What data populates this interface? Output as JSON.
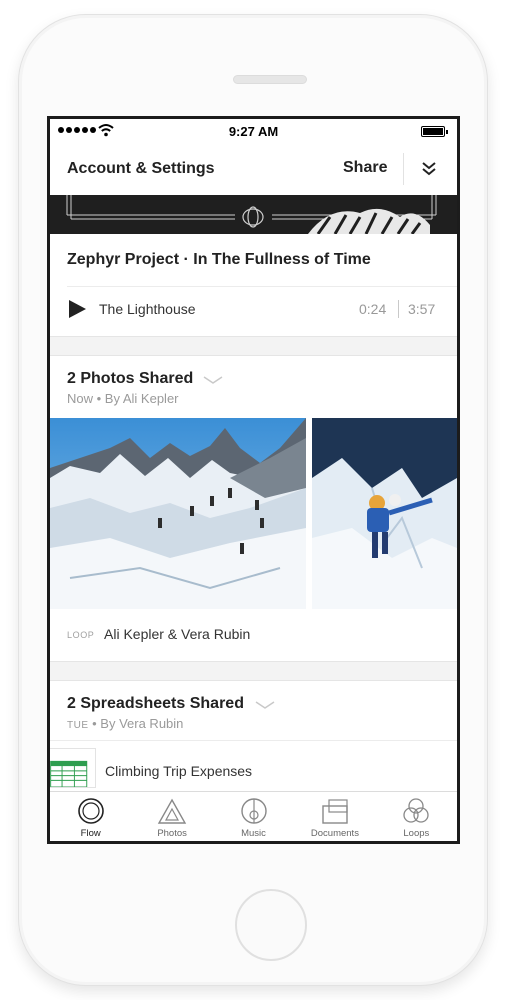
{
  "status_bar": {
    "time": "9:27 AM"
  },
  "header": {
    "title": "Account & Settings",
    "share_label": "Share"
  },
  "music_card": {
    "title": "Zephyr Project · In The Fullness of Time",
    "track": "The Lighthouse",
    "elapsed": "0:24",
    "duration": "3:57"
  },
  "photos_card": {
    "title": "2 Photos Shared",
    "meta_time": "Now",
    "meta_author": "• By Ali Kepler",
    "loop_label": "LOOP",
    "loop_members": "Ali Kepler & Vera Rubin"
  },
  "sheets_card": {
    "title": "2 Spreadsheets Shared",
    "meta_time": "TUE",
    "meta_author": "• By Vera Rubin",
    "file_name": "Climbing Trip Expenses"
  },
  "tabs": [
    {
      "label": "Flow",
      "icon": "flow-icon",
      "active": true
    },
    {
      "label": "Photos",
      "icon": "photos-icon",
      "active": false
    },
    {
      "label": "Music",
      "icon": "music-icon",
      "active": false
    },
    {
      "label": "Documents",
      "icon": "documents-icon",
      "active": false
    },
    {
      "label": "Loops",
      "icon": "loops-icon",
      "active": false
    }
  ],
  "colors": {
    "screen_bg": "#f3f3f3",
    "card_bg": "#ffffff",
    "text_primary": "#222222",
    "text_secondary": "#9a9a9a",
    "banner_bg": "#1f1f1f",
    "sheet_green": "#2e9e4f"
  }
}
